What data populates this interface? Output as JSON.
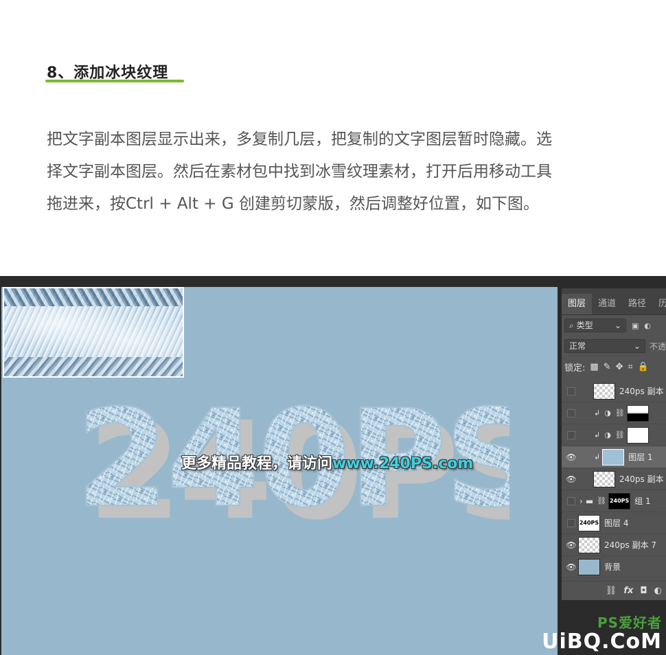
{
  "article": {
    "heading": "8、添加冰块纹理",
    "paragraph_lines": [
      "把文字副本图层显示出来，多复制几层，把复制的文字图层暂时隐藏。选",
      "择文字副本图层。然后在素材包中找到冰雪纹理素材，打开后用移动工具",
      "拖进来，按Ctrl + Alt + G 创建剪切蒙版，然后调整好位置，如下图。"
    ]
  },
  "canvas": {
    "ice_text": "240PS",
    "watermark_text": "更多精品教程，请访问",
    "watermark_url": "www.240PS.com",
    "background_color": "#97b8cc"
  },
  "panel": {
    "tabs": [
      "图层",
      "通道",
      "路径",
      "历"
    ],
    "filter_label": "类型",
    "blend_mode": "正常",
    "opacity_label": "不透",
    "lock_label": "锁定:",
    "layers": [
      {
        "name": "240ps 副本",
        "visible": false,
        "thumb": "checker",
        "clipped": false
      },
      {
        "name": "",
        "visible": false,
        "thumb": "gradient",
        "clipped": true,
        "adjustment": true
      },
      {
        "name": "",
        "visible": false,
        "thumb": "white",
        "clipped": true,
        "adjustment": true
      },
      {
        "name": "图层 1",
        "visible": true,
        "thumb": "ice",
        "clipped": true,
        "selected": true
      },
      {
        "name": "240ps 副本",
        "visible": true,
        "thumb": "checker",
        "clipped": false
      },
      {
        "name": "组 1",
        "visible": false,
        "thumb": "text",
        "thumb_text": "240PS",
        "group": true
      },
      {
        "name": "图层 4",
        "visible": false,
        "thumb": "text-light",
        "thumb_text": "240PS"
      },
      {
        "name": "240ps 副本 7",
        "visible": true,
        "thumb": "checker"
      },
      {
        "name": "背景",
        "visible": true,
        "thumb": "bg"
      }
    ],
    "footer_icons": [
      "link-icon",
      "fx-icon",
      "mask-icon",
      "adjustment-icon"
    ],
    "footer_fx": "fx"
  },
  "logo": {
    "top": "PS爱好者",
    "bottom": "UiBQ.CoM"
  }
}
